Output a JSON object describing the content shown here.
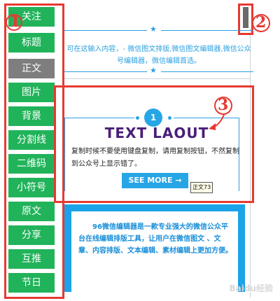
{
  "nav": {
    "items": [
      {
        "label": "关注",
        "active": false
      },
      {
        "label": "标题",
        "active": false
      },
      {
        "label": "正文",
        "active": true
      },
      {
        "label": "图片",
        "active": false
      },
      {
        "label": "背景",
        "active": false
      },
      {
        "label": "分割线",
        "active": false
      },
      {
        "label": "二维码",
        "active": false
      },
      {
        "label": "小符号",
        "active": false
      },
      {
        "label": "原文",
        "active": false
      },
      {
        "label": "分享",
        "active": false
      },
      {
        "label": "互推",
        "active": false
      },
      {
        "label": "节日",
        "active": false
      }
    ]
  },
  "markers": {
    "m1": "1",
    "m2": "2",
    "m3": "3"
  },
  "template1": {
    "text": "可在这输入内容，- 微信图文排版,微信图文编辑器,微信公众号编辑器，微信编辑首选。"
  },
  "template2": {
    "number": "1",
    "title": "TEXT LAOUT",
    "body": "复制时候不要使用键盘复制，请用复制按钮，不然复制到公众号上显示错了。",
    "button": "SEE MORE →",
    "tag": "正文73"
  },
  "template3": {
    "text": "96微信编辑器是一款专业强大的微信公众平台在线编辑排版工具，让用户在微信图文 、文章、内容排版、文本编辑、素材编辑上更加方便。"
  },
  "watermark": "Baidu经验"
}
